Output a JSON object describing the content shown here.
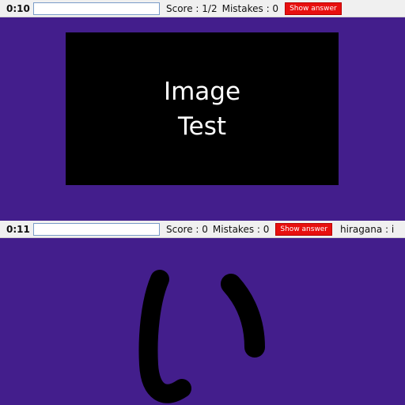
{
  "screen_top": {
    "timer": "0:10",
    "answer_input": {
      "value": "",
      "placeholder": ""
    },
    "score_text": "Score : 1/2",
    "mistakes_text": "Mistakes : 0",
    "show_answer_label": "Show answer",
    "image_card": {
      "line1": "Image",
      "line2": "Test"
    }
  },
  "screen_bottom": {
    "timer": "0:11",
    "answer_input": {
      "value": "",
      "placeholder": ""
    },
    "score_text": "Score : 0",
    "mistakes_text": "Mistakes : 0",
    "show_answer_label": "Show answer",
    "hiragana_text": "hiragana : i",
    "flashcard_glyph": "い"
  },
  "colors": {
    "stage_background": "#431e8c",
    "show_answer_button": "#e8100f",
    "toolbar": "#f0f0f0"
  }
}
